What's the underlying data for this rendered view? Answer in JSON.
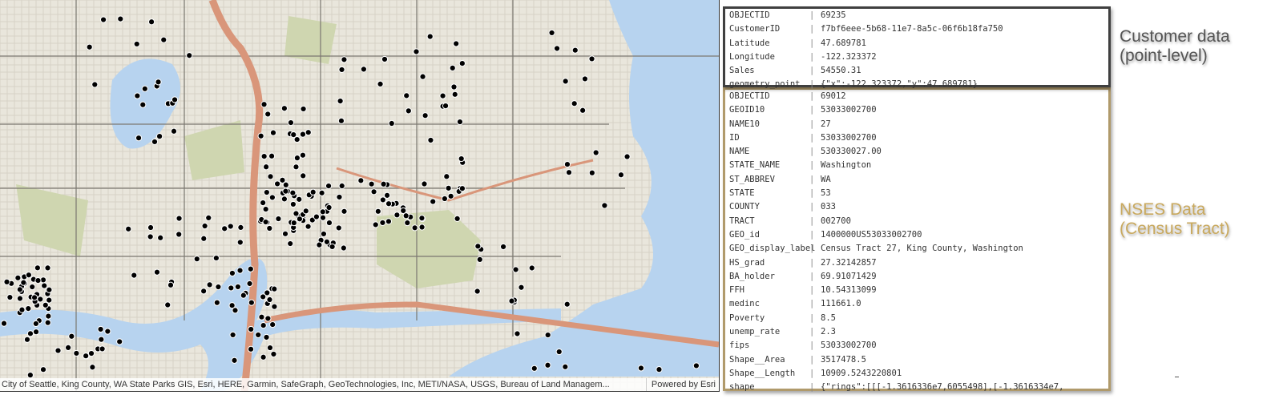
{
  "map": {
    "attribution": "City of Seattle, King County, WA State Parks GIS, Esri, HERE, Garmin, SafeGraph, GeoTechnologies, Inc, METI/NASA, USGS, Bureau of Land Managem...",
    "powered_by": "Powered by Esri"
  },
  "customer": {
    "label_line1": "Customer data",
    "label_line2": "(point-level)",
    "rows": [
      {
        "key": "OBJECTID",
        "value": "69235"
      },
      {
        "key": "CustomerID",
        "value": "f7bf6eee-5b68-11e7-8a5c-06f6b18fa750"
      },
      {
        "key": "Latitude",
        "value": "47.689781"
      },
      {
        "key": "Longitude",
        "value": "-122.323372"
      },
      {
        "key": "Sales",
        "value": "54550.31"
      },
      {
        "key": "geometry_point",
        "value": "{\"x\":-122.323372,\"y\":47.689781}"
      }
    ]
  },
  "nses": {
    "label_line1": "NSES Data",
    "label_line2": "(Census Tract)",
    "rows": [
      {
        "key": "OBJECTID",
        "value": "69012"
      },
      {
        "key": "GEOID10",
        "value": "53033002700"
      },
      {
        "key": "NAME10",
        "value": "27"
      },
      {
        "key": "ID",
        "value": "53033002700"
      },
      {
        "key": "NAME",
        "value": "530330027.00"
      },
      {
        "key": "STATE_NAME",
        "value": "Washington"
      },
      {
        "key": "ST_ABBREV",
        "value": "WA"
      },
      {
        "key": "STATE",
        "value": "53"
      },
      {
        "key": "COUNTY",
        "value": "033"
      },
      {
        "key": "TRACT",
        "value": "002700"
      },
      {
        "key": "GEO_id",
        "value": "1400000US53033002700"
      },
      {
        "key": "GEO_display_label",
        "value": "Census Tract 27, King County, Washington"
      },
      {
        "key": "HS_grad",
        "value": "27.32142857"
      },
      {
        "key": "BA_holder",
        "value": "69.91071429"
      },
      {
        "key": "FFH",
        "value": "10.54313099"
      },
      {
        "key": "medinc",
        "value": "111661.0"
      },
      {
        "key": "Poverty",
        "value": "8.5"
      },
      {
        "key": "unemp_rate",
        "value": "2.3"
      },
      {
        "key": "fips",
        "value": "53033002700"
      },
      {
        "key": "Shape__Area",
        "value": "3517478.5"
      },
      {
        "key": "Shape__Length",
        "value": "10909.5243220801"
      },
      {
        "key": "shape",
        "value": "{\"rings\":[[[-1.3616336e7,6055498],[-1.3616334e7,"
      }
    ]
  },
  "colors": {
    "water": "#b7d3ef",
    "land": "#e9e6dc",
    "park": "#cfd6b0",
    "highway": "#d9967a",
    "customer_border": "#3f3f3f",
    "nses_border": "#b09a6b"
  }
}
